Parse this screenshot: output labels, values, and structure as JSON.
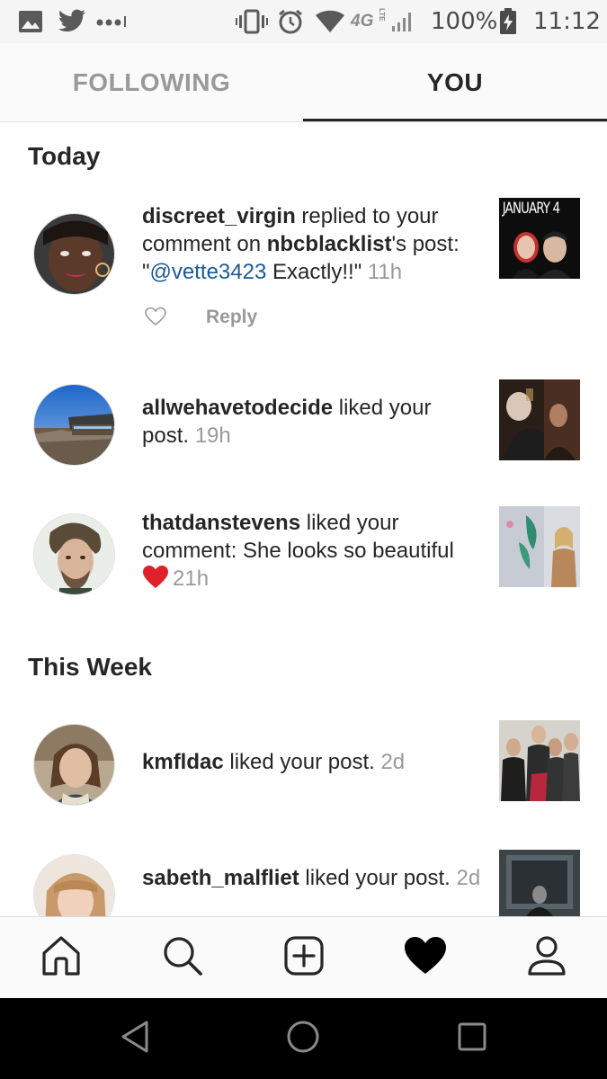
{
  "status_bar": {
    "network_label": "4G",
    "network_sub": "LTE",
    "battery": "100%",
    "time": "11:12",
    "left_icons": [
      "gallery-icon",
      "twitter-icon",
      "more-dots-icon"
    ],
    "right_icons": [
      "vibrate-icon",
      "alarm-icon",
      "wifi-icon",
      "signal-icon",
      "battery-charging-icon"
    ]
  },
  "tabs": [
    {
      "label": "FOLLOWING",
      "active": false
    },
    {
      "label": "YOU",
      "active": true
    }
  ],
  "sections": {
    "today": "Today",
    "this_week": "This Week"
  },
  "notifications": [
    {
      "user": "discreet_virgin",
      "text_1": " replied to your comment on ",
      "target_user": "nbcblacklist",
      "text_2": "'s post: \"",
      "mention": "@vette3423",
      "text_3": " Exactly!!\" ",
      "time": "11h",
      "reply_label": "Reply",
      "thumb_caption": "JANUARY 4"
    },
    {
      "user": "allwehavetodecide",
      "text_1": " liked your post. ",
      "time": "19h"
    },
    {
      "user": "thatdanstevens",
      "text_1": " liked your comment: She looks so beautiful ",
      "emoji": "❤️",
      "time": "21h"
    },
    {
      "user": "kmfldac",
      "text_1": " liked your post. ",
      "time": "2d"
    },
    {
      "user": "sabeth_malfliet",
      "text_1": " liked your post. ",
      "time": "2d"
    }
  ],
  "bottom_nav": [
    {
      "icon": "home-icon"
    },
    {
      "icon": "search-icon"
    },
    {
      "icon": "new-post-icon"
    },
    {
      "icon": "activity-heart-icon",
      "active": true
    },
    {
      "icon": "profile-icon"
    }
  ],
  "android_nav": [
    "back-icon",
    "home-circle-icon",
    "recents-icon"
  ],
  "colors": {
    "text": "#262626",
    "muted": "#999999",
    "mention": "#1a5a96",
    "heart_emoji": "#e0202a",
    "tab_bar_bg": "#fafafa",
    "status_bar_bg": "#f5f5f5"
  }
}
